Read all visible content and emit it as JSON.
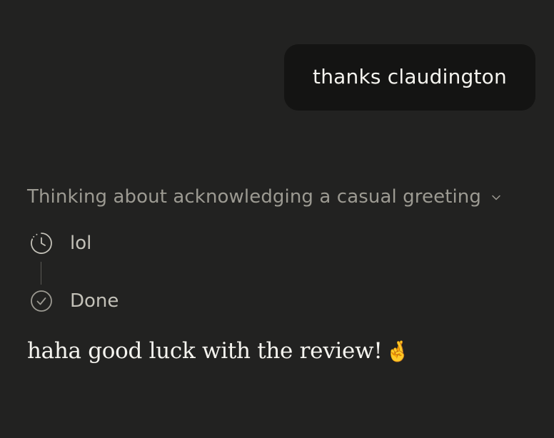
{
  "user_message": {
    "text": "thanks claudington"
  },
  "thinking": {
    "title": "Thinking about acknowledging a casual greeting",
    "chevron_icon": "chevron-down-icon",
    "steps": [
      {
        "icon": "clock-icon",
        "label": "lol"
      },
      {
        "icon": "check-circle-icon",
        "label": "Done"
      }
    ]
  },
  "assistant_message": {
    "text": "haha good luck with the review!",
    "emoji": "🤞"
  },
  "colors": {
    "background": "#222221",
    "user_bubble": "#141413",
    "text_primary": "#f5f4ef",
    "text_muted": "#9c9a92"
  }
}
